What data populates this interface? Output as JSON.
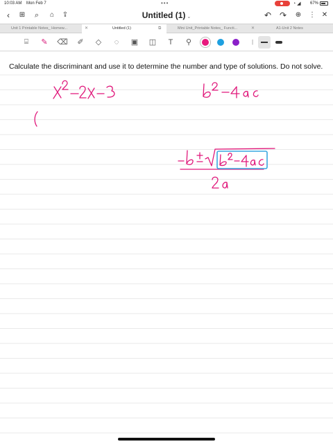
{
  "status": {
    "time": "10:03 AM",
    "date": "Mon Feb 7",
    "battery": "67%"
  },
  "nav": {
    "title": "Untitled (1)",
    "icons": [
      "back-icon",
      "grid-icon",
      "search-icon",
      "bookmark-icon",
      "share-icon",
      "undo-icon",
      "redo-icon",
      "add-page-icon",
      "more-icon",
      "close-icon"
    ]
  },
  "tabs": [
    {
      "label": "Unit 1 Printable Notes_ Homew...",
      "active": false
    },
    {
      "label": "Untitled (1)",
      "active": true
    },
    {
      "label": "Mini Unit_Printable Notes_ Functi...",
      "active": false
    },
    {
      "label": "A1-Unit 2 Notes",
      "active": false
    }
  ],
  "toolbar": {
    "tools": [
      "lasso-icon",
      "pen-icon",
      "eraser-icon",
      "highlighter-icon",
      "shapes-icon",
      "lasso-select-icon",
      "image-icon",
      "text-icon",
      "link-icon"
    ],
    "colors": [
      "#e8197e",
      "#1ea0e0",
      "#8a1fc8"
    ]
  },
  "page": {
    "question": "Calculate the discriminant and use it to determine the number and type of solutions. Do not solve.",
    "ink_color": "#e0167a",
    "highlight_color": "#3aa7e0"
  }
}
